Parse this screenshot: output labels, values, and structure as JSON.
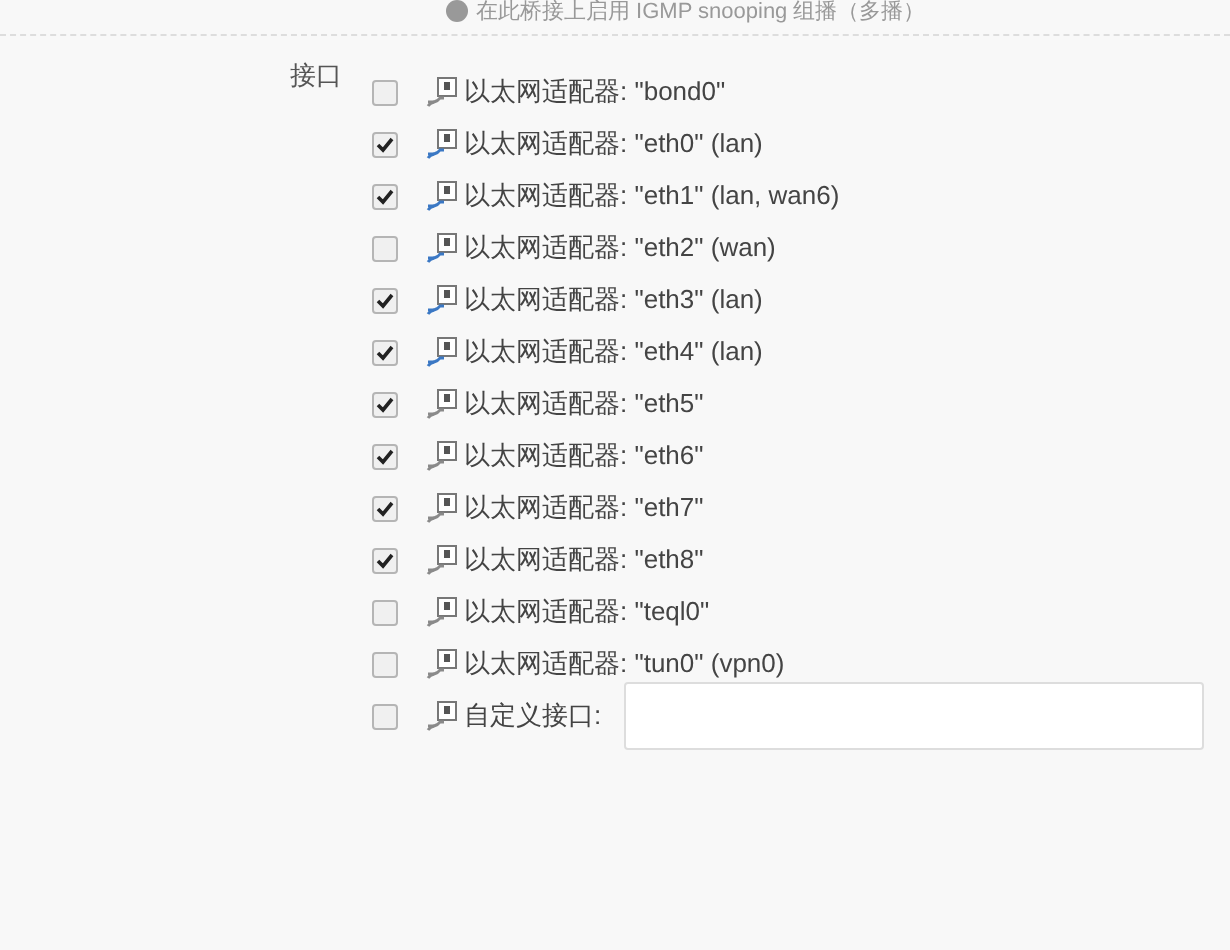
{
  "hint": "在此桥接上启用 IGMP snooping 组播（多播）",
  "field_label": "接口",
  "interfaces": [
    {
      "kind": "adapter",
      "label": "以太网适配器: \"bond0\"",
      "checked": false,
      "link_up": false
    },
    {
      "kind": "adapter",
      "label": "以太网适配器: \"eth0\" (lan)",
      "checked": true,
      "link_up": true
    },
    {
      "kind": "adapter",
      "label": "以太网适配器: \"eth1\" (lan, wan6)",
      "checked": true,
      "link_up": true
    },
    {
      "kind": "adapter",
      "label": "以太网适配器: \"eth2\" (wan)",
      "checked": false,
      "link_up": true
    },
    {
      "kind": "adapter",
      "label": "以太网适配器: \"eth3\" (lan)",
      "checked": true,
      "link_up": true
    },
    {
      "kind": "adapter",
      "label": "以太网适配器: \"eth4\" (lan)",
      "checked": true,
      "link_up": true
    },
    {
      "kind": "adapter",
      "label": "以太网适配器: \"eth5\"",
      "checked": true,
      "link_up": false
    },
    {
      "kind": "adapter",
      "label": "以太网适配器: \"eth6\"",
      "checked": true,
      "link_up": false
    },
    {
      "kind": "adapter",
      "label": "以太网适配器: \"eth7\"",
      "checked": true,
      "link_up": false
    },
    {
      "kind": "adapter",
      "label": "以太网适配器: \"eth8\"",
      "checked": true,
      "link_up": false
    },
    {
      "kind": "adapter",
      "label": "以太网适配器: \"teql0\"",
      "checked": false,
      "link_up": false
    },
    {
      "kind": "adapter",
      "label": "以太网适配器: \"tun0\" (vpn0)",
      "checked": false,
      "link_up": false
    },
    {
      "kind": "custom",
      "label": "自定义接口:",
      "checked": false,
      "link_up": false
    }
  ]
}
